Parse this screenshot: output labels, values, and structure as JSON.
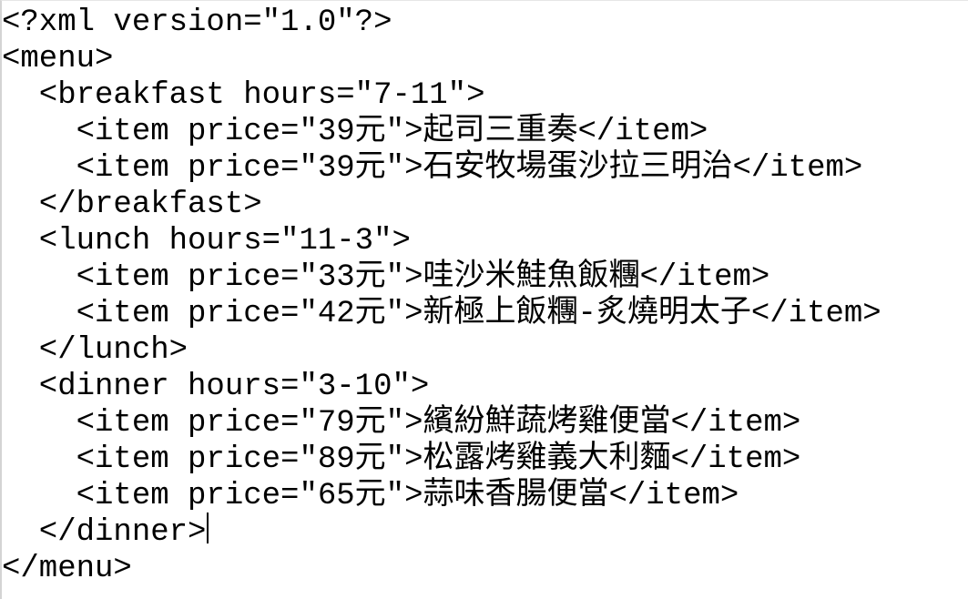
{
  "editor": {
    "lines": [
      "<?xml version=\"1.0\"?>",
      "<menu>",
      "  <breakfast hours=\"7-11\">",
      "    <item price=\"39元\">起司三重奏</item>",
      "    <item price=\"39元\">石安牧場蛋沙拉三明治</item>",
      "  </breakfast>",
      "  <lunch hours=\"11-3\">",
      "    <item price=\"33元\">哇沙米鮭魚飯糰</item>",
      "    <item price=\"42元\">新極上飯糰-炙燒明太子</item>",
      "  </lunch>",
      "  <dinner hours=\"3-10\">",
      "    <item price=\"79元\">繽紛鮮蔬烤雞便當</item>",
      "    <item price=\"89元\">松露烤雞義大利麵</item>",
      "    <item price=\"65元\">蒜味香腸便當</item>",
      "  </dinner>",
      "</menu>"
    ],
    "caret_line": 15,
    "text_color": "#000000",
    "background_color": "#ffffff"
  }
}
